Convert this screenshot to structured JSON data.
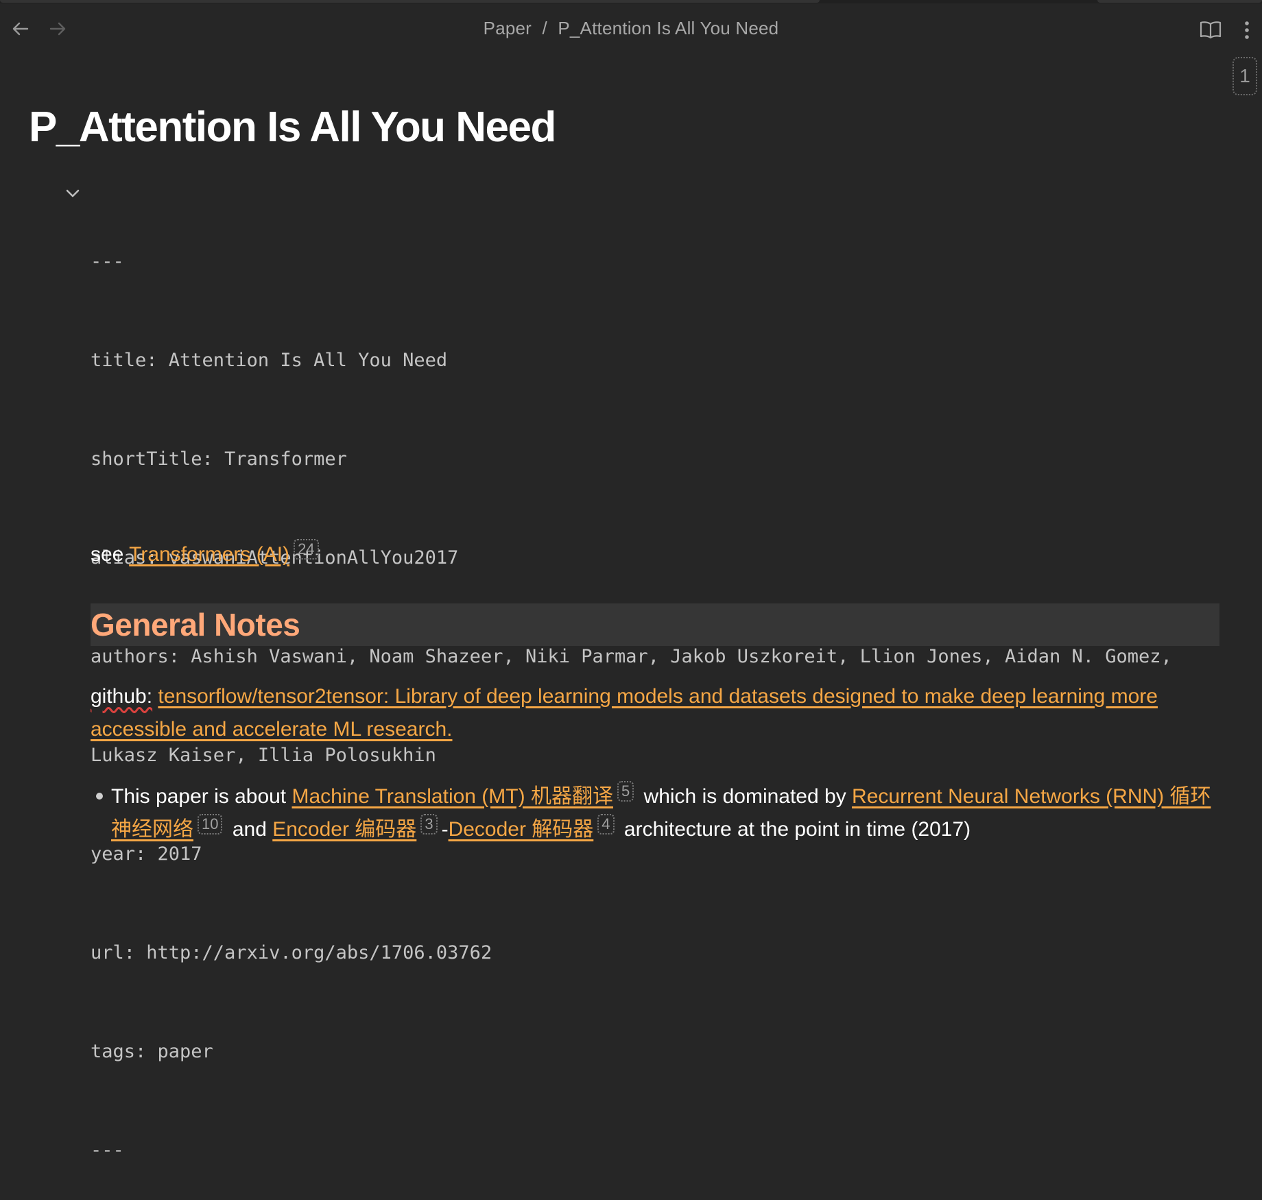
{
  "breadcrumb": {
    "folder": "Paper",
    "separator": "/",
    "note": "P_Attention Is All You Need"
  },
  "page_badge": "1",
  "title": "P_Attention Is All You Need",
  "frontmatter": {
    "open": "---",
    "lines": [
      "title: Attention Is All You Need",
      "shortTitle: Transformer",
      "alias: vaswaniAttentionAllYou2017",
      "authors: Ashish Vaswani, Noam Shazeer, Niki Parmar, Jakob Uszkoreit, Llion Jones, Aidan N. Gomez,",
      "Lukasz Kaiser, Illia Polosukhin",
      "year: 2017",
      "url: http://arxiv.org/abs/1706.03762",
      "tags: paper"
    ],
    "close": "---"
  },
  "see": {
    "prefix": "see",
    "link": "Transformers (AI)",
    "count": "24"
  },
  "heading": "General Notes",
  "github": {
    "prefix": "github:",
    "link": "tensorflow/tensor2tensor: Library of deep learning models and datasets designed to make deep learning more accessible and accelerate ML research."
  },
  "bullet": {
    "t1": "This paper is about",
    "l1": "Machine Translation (MT) 机器翻译",
    "c1": "5",
    "t2": "which is dominated by",
    "l2": "Recurrent Neural Networks (RNN) 循环神经网络",
    "c2": "10",
    "t3": "and",
    "l3": "Encoder 编码器",
    "c3": "3",
    "t4": "-",
    "l4": "Decoder 解码器",
    "c4": "4",
    "t5": "architecture at the point in time (2017)"
  },
  "colors": {
    "background": "#262626",
    "link": "#f6a745",
    "heading": "#ffa879",
    "text": "#ffffff"
  },
  "icons": {
    "back": "arrow-left-icon",
    "forward": "arrow-right-icon",
    "reader": "open-book-icon",
    "more": "more-vertical-icon",
    "fold": "chevron-down-icon"
  }
}
